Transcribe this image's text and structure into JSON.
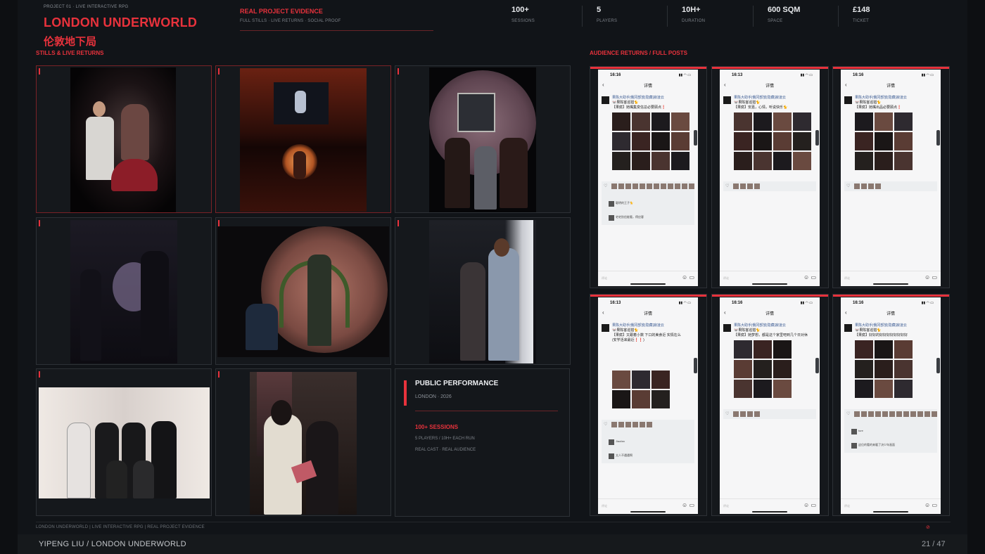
{
  "header": {
    "project_label": "PROJECT 01 · LIVE INTERACTIVE RPG",
    "title_en": "LONDON UNDERWORLD",
    "title_zh": "伦敦地下局",
    "evidence_title": "REAL PROJECT EVIDENCE",
    "evidence_sub": "FULL STILLS · LIVE RETURNS · SOCIAL PROOF"
  },
  "stats": [
    {
      "value": "100+",
      "label": "SESSIONS"
    },
    {
      "value": "5",
      "label": "PLAYERS"
    },
    {
      "value": "10H+",
      "label": "DURATION"
    },
    {
      "value": "600 SQM",
      "label": "SPACE"
    },
    {
      "value": "£148",
      "label": "TICKET"
    }
  ],
  "sections": {
    "left": "STILLS & LIVE RETURNS",
    "right": "AUDIENCE RETURNS / FULL POSTS"
  },
  "performance": {
    "heading": "PUBLIC PERFORMANCE",
    "location": "LONDON · 2026",
    "sessions": "100+ SESSIONS",
    "line1": "5 PLAYERS / 10H+ EACH RUN",
    "line2": "REAL CAST · REAL AUDIENCE"
  },
  "phones": [
    {
      "time": "16:16",
      "title": "详情",
      "post_lines": [
        "果陈大助手|俄冈部放|隐藏|寂凌云",
        "🐭果陈客巡猎🐈",
        "【果腐】她嘴集变信总必要顾点❗"
      ],
      "input_placeholder": "评论",
      "comments": [
        "聪明的王子🐈",
        "宅宅别信能看，得应客"
      ]
    },
    {
      "time": "16:13",
      "title": "详情",
      "post_lines": [
        "果陈大助手|俄冈部放|隐藏|寂凌云",
        "🐭果陈客巡猎🐈",
        "【果腐】安嘉，心情，听说快乐🐈"
      ],
      "input_placeholder": "评论",
      "comments": []
    },
    {
      "time": "16:16",
      "title": "详情",
      "post_lines": [
        "果陈大助手|俄冈部放|隐藏|寂凌云",
        "🐭果陈客巡猎🐈",
        "【果腐】她嘴出品必要顾点❗"
      ],
      "input_placeholder": "评论",
      "comments": []
    },
    {
      "time": "16:13",
      "title": "详情",
      "post_lines": [
        "果陈大助手|俄冈部放|隐藏|寂凌云",
        "🐭果陈客巡猎🐈",
        "【果腐】又跟着小数 下口的美食近 实情在么",
        "(安学活来最近❗❗)"
      ],
      "input_placeholder": "评论",
      "comments": [
        "Jiaofan",
        "太人不遇遇啊"
      ]
    },
    {
      "time": "16:16",
      "title": "详情",
      "post_lines": [
        "果陈大助手|俄冈部放|隐藏|寂凌云",
        "🐭果陈客巡猎🐈",
        "【果腐】她梦想，都是这个家里吧到几个日对休"
      ],
      "input_placeholder": "评论",
      "comments": []
    },
    {
      "time": "16:16",
      "title": "详情",
      "post_lines": [
        "果陈大助手|俄冈部放|隐藏|寂凌云",
        "🐭果陈客巡猎🐈",
        "【果腐】好好的好好好好好好好好"
      ],
      "input_placeholder": "评论",
      "comments": [
        "ture",
        "这位的看的来暖了决少年画面"
      ]
    }
  ],
  "footer": {
    "breadcrumb": "LONDON UNDERWORLD  |  LIVE INTERACTIVE RPG  |  REAL PROJECT EVIDENCE",
    "author": "YIPENG LIU  /  LONDON UNDERWORLD",
    "page": "21 / 47"
  },
  "colors": {
    "accent": "#e8323c",
    "bg": "#111418"
  }
}
